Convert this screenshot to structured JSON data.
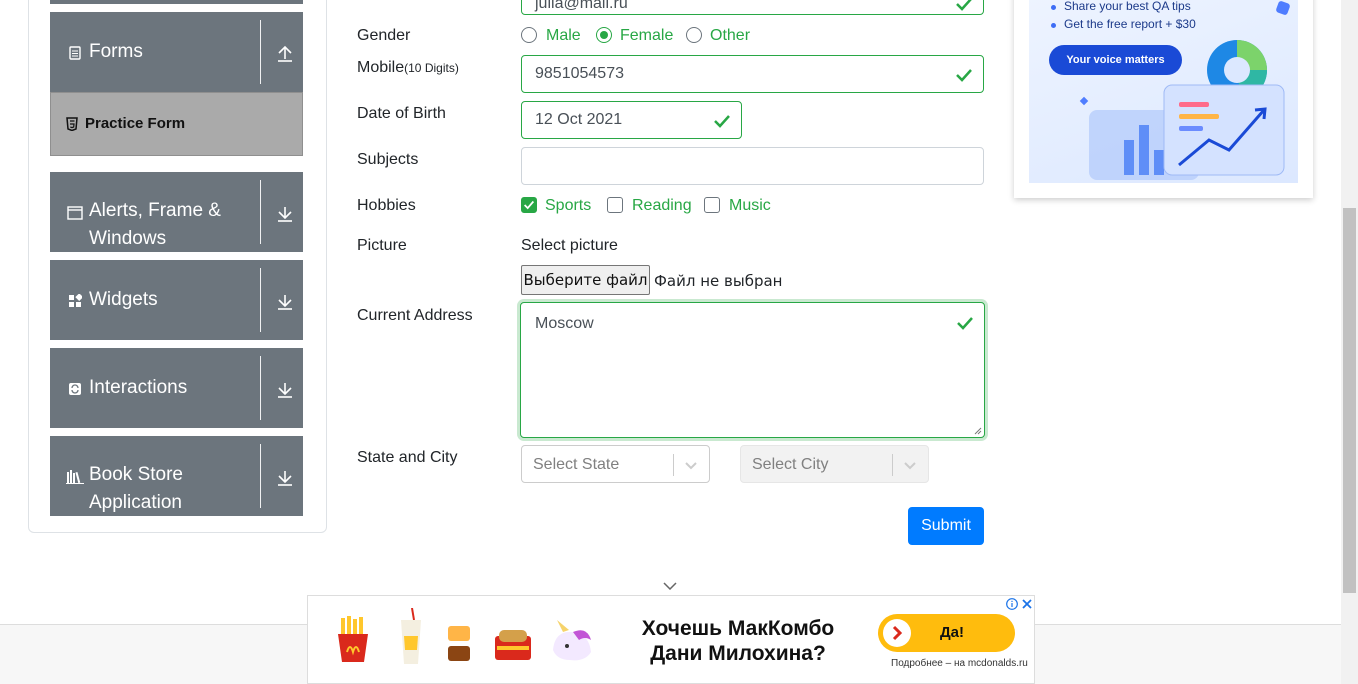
{
  "sidebar": {
    "groups": [
      {
        "title": "Forms",
        "icon": "document-icon"
      },
      {
        "title": "Alerts, Frame & Windows",
        "title_line1": "Alerts, Frame &",
        "title_line2": "Windows",
        "icon": "window-icon"
      },
      {
        "title": "Widgets",
        "icon": "widgets-icon"
      },
      {
        "title": "Interactions",
        "icon": "interactions-icon"
      },
      {
        "title": "Book Store Application",
        "title_line1": "Book Store",
        "title_line2": "Application",
        "icon": "books-icon"
      }
    ],
    "active_item": {
      "label": "Practice Form",
      "icon": "html5-icon"
    }
  },
  "form": {
    "email_value": "julia@mail.ru",
    "gender": {
      "label": "Gender",
      "options": [
        "Male",
        "Female",
        "Other"
      ],
      "selected": "Female"
    },
    "mobile": {
      "label": "Mobile",
      "hint": "(10 Digits)",
      "value": "9851054573"
    },
    "dob": {
      "label": "Date of Birth",
      "value": "12 Oct 2021"
    },
    "subjects": {
      "label": "Subjects",
      "value": ""
    },
    "hobbies": {
      "label": "Hobbies",
      "options": [
        "Sports",
        "Reading",
        "Music"
      ],
      "checked": [
        "Sports"
      ]
    },
    "picture": {
      "label": "Picture",
      "caption": "Select picture",
      "button": "Выберите файл",
      "status": "Файл не выбран"
    },
    "address": {
      "label": "Current Address",
      "value": "Moscow"
    },
    "state_city": {
      "label": "State and City",
      "state_placeholder": "Select State",
      "city_placeholder": "Select City"
    },
    "submit": "Submit"
  },
  "qa_ad": {
    "lines": [
      "Share your best QA tips",
      "Get the free report + $30"
    ],
    "button": "Your voice matters"
  },
  "mc_ad": {
    "title_line1": "Хочешь МакКомбо",
    "title_line2": "Дани Милохина?",
    "button": "Да!",
    "more": "Подробнее – на mcdonalds.ru"
  },
  "colors": {
    "valid": "#28a745",
    "primary": "#007bff",
    "sidebar": "#6c757d",
    "active_item": "#aaaaaa"
  }
}
